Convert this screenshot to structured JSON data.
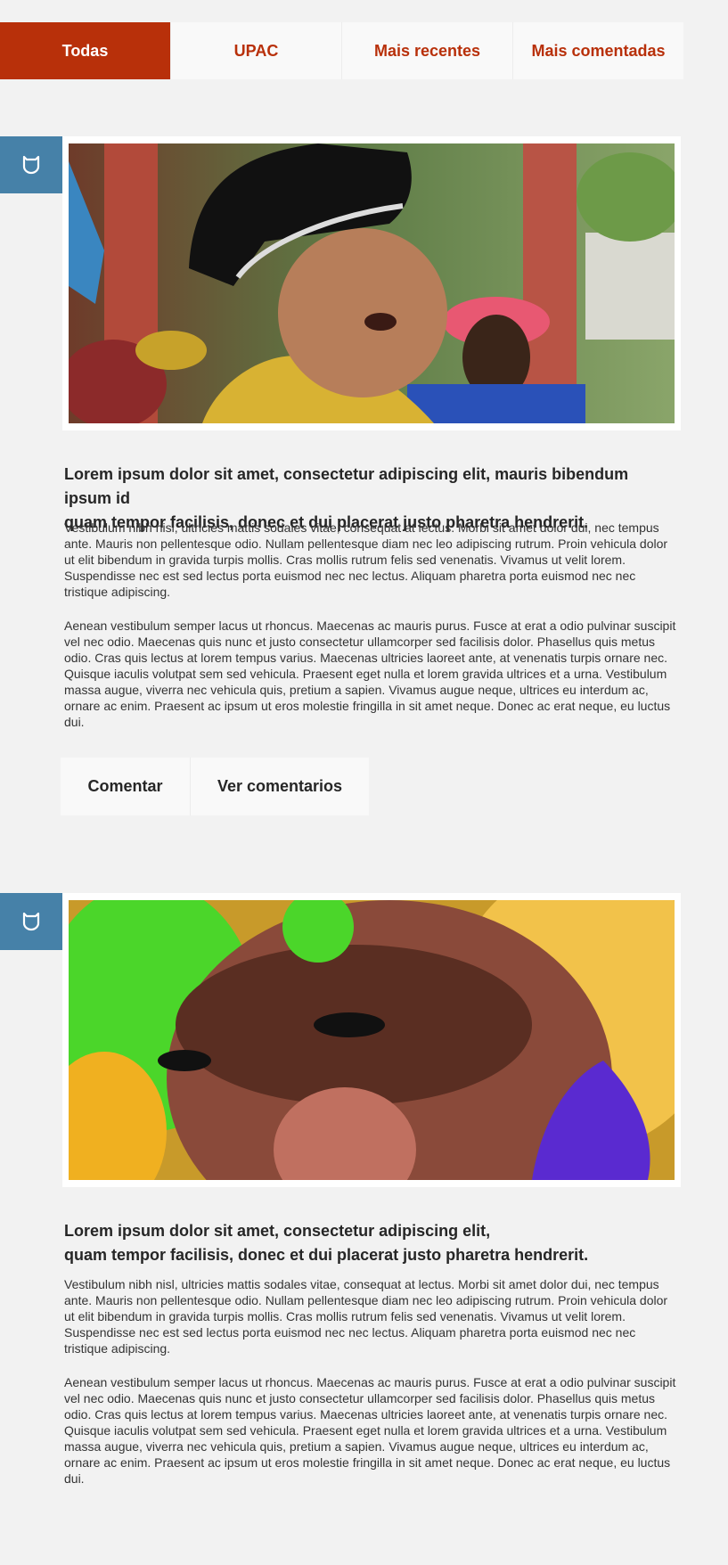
{
  "tabs": [
    {
      "label": "Todas",
      "active": true
    },
    {
      "label": "UPAC",
      "active": false
    },
    {
      "label": "Mais recentes",
      "active": false
    },
    {
      "label": "Mais comentadas",
      "active": false
    }
  ],
  "posts": [
    {
      "title_line1": "Lorem ipsum dolor sit amet, consectetur adipiscing elit, mauris bibendum ipsum id",
      "title_line2": "quam tempor facilisis, donec et dui placerat justo pharetra hendrerit.",
      "paragraph1": "Vestibulum nibh nisl, ultricies mattis sodales vitae, consequat at lectus. Morbi sit amet dolor dui, nec tempus ante. Mauris non pellentesque odio. Nullam pellentesque diam nec leo adipiscing rutrum. Proin vehicula dolor ut elit bibendum in gravida turpis mollis. Cras mollis rutrum felis sed venenatis. Vivamus ut velit lorem. Suspendisse nec est sed lectus porta euismod nec nec lectus. Aliquam pharetra porta euismod nec nec tristique adipiscing.",
      "paragraph2": "Aenean vestibulum semper lacus ut rhoncus. Maecenas ac mauris purus. Fusce at erat a odio pulvinar suscipit vel nec odio. Maecenas quis nunc et justo consectetur ullamcorper sed facilisis dolor. Phasellus quis metus odio. Cras quis lectus at lorem tempus varius. Maecenas ultricies laoreet ante, at venenatis turpis ornare nec. Quisque iaculis volutpat sem sed vehicula. Praesent eget nulla et lorem gravida ultrices et a urna. Vestibulum massa augue, viverra nec vehicula quis, pretium a sapien. Vivamus augue neque, ultrices eu interdum ac, ornare ac enim. Praesent ac ipsum ut eros molestie fringilla in sit amet neque. Donec ac erat neque, eu luctus dui.",
      "comment_label": "Comentar",
      "view_comments_label": "Ver comentarios",
      "badge_icon": "shield-icon"
    },
    {
      "title_line1": "Lorem ipsum dolor sit amet, consectetur adipiscing elit,",
      "title_line2": "quam tempor facilisis, donec et dui placerat justo pharetra hendrerit.",
      "paragraph1": "Vestibulum nibh nisl, ultricies mattis sodales vitae, consequat at lectus. Morbi sit amet dolor dui, nec tempus ante. Mauris non pellentesque odio. Nullam pellentesque diam nec leo adipiscing rutrum. Proin vehicula dolor ut elit bibendum in gravida turpis mollis. Cras mollis rutrum felis sed venenatis. Vivamus ut velit lorem. Suspendisse nec est sed lectus porta euismod nec nec lectus. Aliquam pharetra porta euismod nec nec tristique adipiscing.",
      "paragraph2": "Aenean vestibulum semper lacus ut rhoncus. Maecenas ac mauris purus. Fusce at erat a odio pulvinar suscipit vel nec odio. Maecenas quis nunc et justo consectetur ullamcorper sed facilisis dolor. Phasellus quis metus odio. Cras quis lectus at lorem tempus varius. Maecenas ultricies laoreet ante, at venenatis turpis ornare nec. Quisque iaculis volutpat sem sed vehicula. Praesent eget nulla et lorem gravida ultrices et a urna. Vestibulum massa augue, viverra nec vehicula quis, pretium a sapien. Vivamus augue neque, ultrices eu interdum ac, ornare ac enim. Praesent ac ipsum ut eros molestie fringilla in sit amet neque. Donec ac erat neque, eu luctus dui.",
      "badge_icon": "shield-icon"
    }
  ],
  "colors": {
    "accent": "#b8300a",
    "badge": "#4681a8",
    "background": "#f2f2f2"
  }
}
